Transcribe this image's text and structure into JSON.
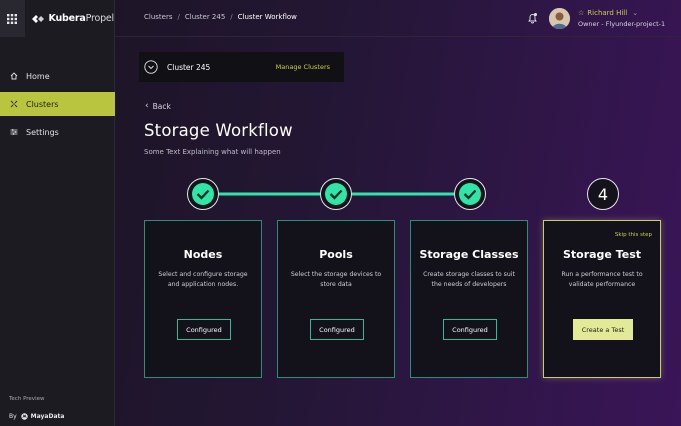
{
  "brand": {
    "name_bold": "Kubera",
    "name_light": "Propel"
  },
  "sidebar": {
    "items": [
      {
        "label": "Home",
        "icon": "home-icon",
        "active": false
      },
      {
        "label": "Clusters",
        "icon": "clusters-icon",
        "active": true
      },
      {
        "label": "Settings",
        "icon": "settings-icon",
        "active": false
      }
    ],
    "tech_preview": "Tech Preview",
    "by_label": "By",
    "company": "MayaData"
  },
  "breadcrumb": [
    "Clusters",
    "Cluster 245",
    "Cluster Workflow"
  ],
  "user": {
    "name": "Richard Hill",
    "role": "Owner - Flyunder-project-1"
  },
  "cluster_selector": {
    "name": "Cluster 245",
    "manage_label": "Manage Clusters"
  },
  "page": {
    "back_label": "Back",
    "title": "Storage Workflow",
    "subtitle": "Some Text Explaining what will happen"
  },
  "stepper": {
    "last_step_number": "4"
  },
  "cards": [
    {
      "title": "Nodes",
      "desc_line1": "Select and configure storage",
      "desc_line2": "and application nodes.",
      "button": "Configured"
    },
    {
      "title": "Pools",
      "desc_line1": "Select the storage devices to",
      "desc_line2": "store data",
      "button": "Configured"
    },
    {
      "title": "Storage Classes",
      "desc_line1": "Create storage classes to suit",
      "desc_line2": "the needs of developers",
      "button": "Configured"
    },
    {
      "title": "Storage Test",
      "desc_line1": "Run a performance test to",
      "desc_line2": "validate  performance",
      "button": "Create a Test",
      "skip": "Skip this step"
    }
  ],
  "colors": {
    "accent_lime": "#b9c53f",
    "step_done_green": "#2ee6a8",
    "card_border": "#2d8e78",
    "button_fill": "#e2ea97"
  }
}
